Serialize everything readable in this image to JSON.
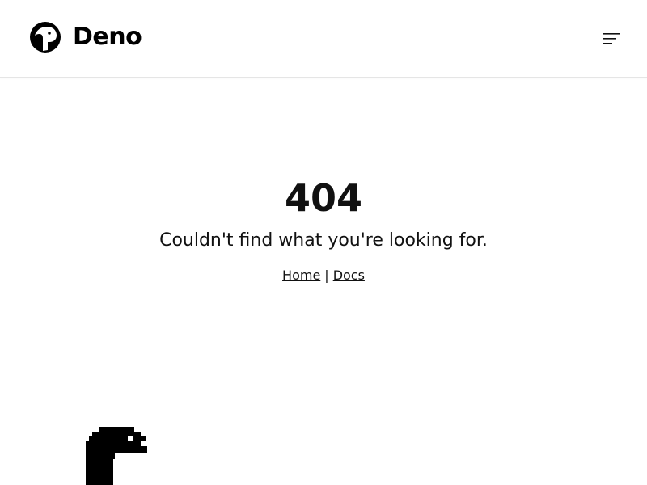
{
  "header": {
    "brand": "Deno",
    "menu_icon": "hamburger-menu-icon"
  },
  "error": {
    "code": "404",
    "message": "Couldn't find what you're looking for."
  },
  "links": {
    "home": "Home",
    "separator": "|",
    "docs": "Docs"
  },
  "colors": {
    "text": "#111111",
    "background": "#ffffff",
    "border": "#e5e5e5"
  }
}
